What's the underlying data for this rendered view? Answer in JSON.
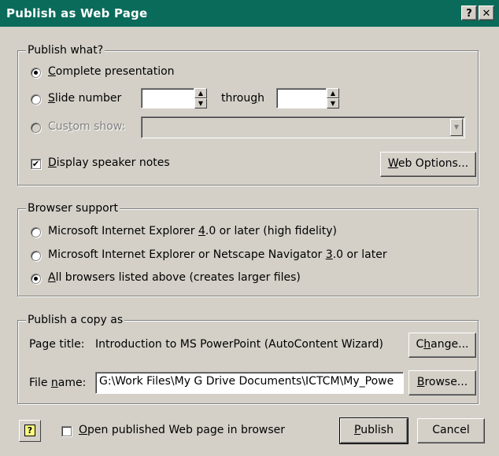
{
  "window": {
    "title": "Publish as Web Page",
    "help_glyph": "?",
    "close_glyph": "✕"
  },
  "publish_what": {
    "legend": "Publish what?",
    "complete_presentation": {
      "pre": "",
      "key": "C",
      "post": "omplete presentation"
    },
    "slide_number": {
      "pre": "",
      "key": "S",
      "post": "lide number"
    },
    "slide_from": "",
    "through": {
      "pre": "throu",
      "key": "g",
      "post": "h"
    },
    "slide_to": "",
    "custom_show": {
      "pre": "Cus",
      "key": "t",
      "post": "om show:"
    },
    "custom_show_value": "",
    "display_notes": {
      "pre": "",
      "key": "D",
      "post": "isplay speaker notes"
    },
    "display_notes_checked": true,
    "web_options": {
      "pre": "",
      "key": "W",
      "post": "eb Options..."
    }
  },
  "browser_support": {
    "legend": "Browser support",
    "ie4": {
      "pre": "Microsoft Internet Explorer ",
      "key": "4",
      "post": ".0 or later (high fidelity)"
    },
    "ie3": {
      "pre": "Microsoft Internet Explorer or Netscape Navigator ",
      "key": "3",
      "post": ".0 or later"
    },
    "all": {
      "pre": "",
      "key": "A",
      "post": "ll browsers listed above (creates larger files)"
    }
  },
  "publish_copy": {
    "legend": "Publish a copy as",
    "page_title_label": "Page title:",
    "page_title_value": "Introduction to MS PowerPoint (AutoContent Wizard)",
    "change": {
      "pre": "C",
      "key": "h",
      "post": "ange..."
    },
    "file_name_label": {
      "pre": "File ",
      "key": "n",
      "post": "ame:"
    },
    "file_name_value": "G:\\Work Files\\My G Drive Documents\\ICTCM\\My_Powe",
    "browse": {
      "pre": "",
      "key": "B",
      "post": "rowse..."
    }
  },
  "footer": {
    "help_icon_glyph": "?",
    "open_in_browser": {
      "pre": "",
      "key": "O",
      "post": "pen published Web page in browser"
    },
    "open_in_browser_checked": false,
    "publish": {
      "pre": "",
      "key": "P",
      "post": "ublish"
    },
    "cancel": "Cancel"
  },
  "colors": {
    "title_bar": "#0a6b5a",
    "face": "#d4d0c8"
  }
}
